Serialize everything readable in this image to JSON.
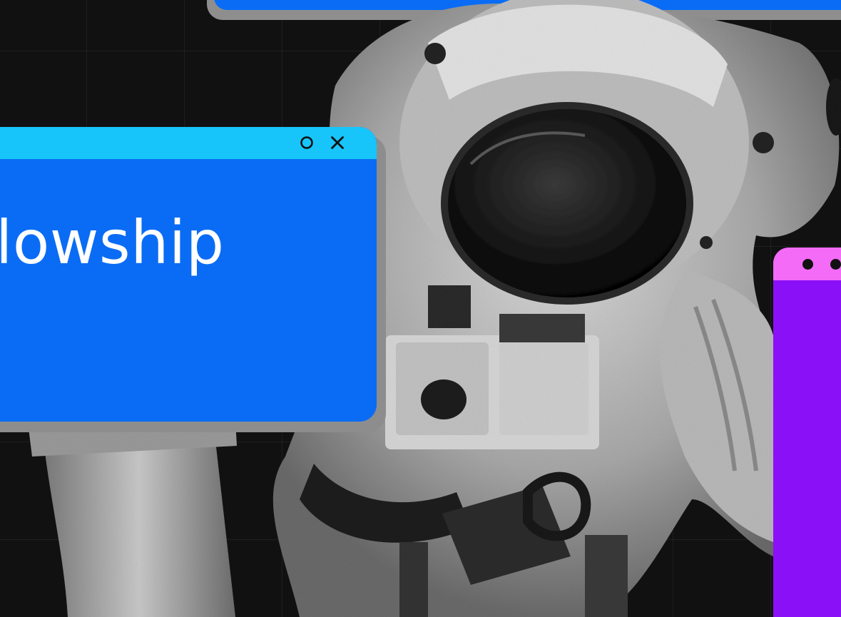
{
  "scene": {
    "background_color": "#111111",
    "grid_line_color": "rgba(255,255,255,0.06)"
  },
  "top_window": {
    "body_color": "#0a6cf5",
    "shadow_color": "#8e8e8e"
  },
  "blue_window": {
    "titlebar_color": "#17c5fb",
    "body_color": "#0a6cf5",
    "shadow_color": "#8d8d8d",
    "title": "lowship",
    "controls": [
      {
        "icon": "circle-icon",
        "label": "restore"
      },
      {
        "icon": "close-icon",
        "label": "close"
      }
    ]
  },
  "purple_window": {
    "titlebar_color": "#f36bf6",
    "body_color": "#8a10f7",
    "dot_color": "#111111",
    "controls": [
      "dot-icon",
      "dot-icon"
    ]
  },
  "image": {
    "subject": "astronaut-photo",
    "style": "black-and-white"
  }
}
